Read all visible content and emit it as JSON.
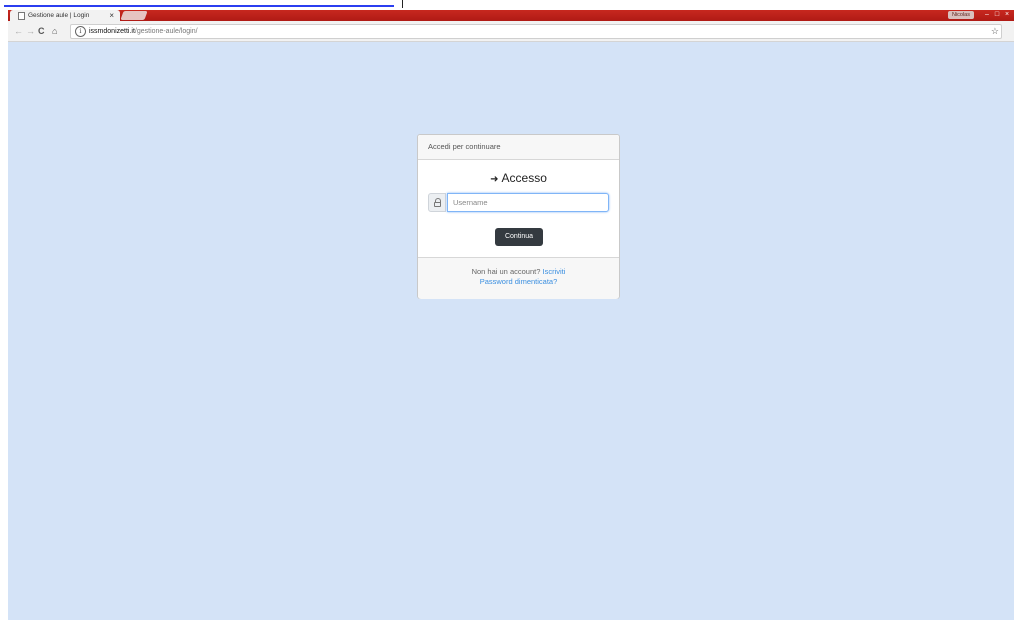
{
  "browser": {
    "tab_title": "Gestione aule | Login",
    "tab_close": "×",
    "user_badge": "Nicolas",
    "window_controls": [
      "–",
      "□",
      "×"
    ],
    "nav": {
      "back": "←",
      "forward": "→",
      "reload": "C",
      "home": "⌂"
    },
    "url_domain": "issmdonizetti.it",
    "url_path": "/gestione-aule/login/",
    "bookmark_star": "☆"
  },
  "login": {
    "header": "Accedi per continuare",
    "title_icon": "➜",
    "title": "Accesso",
    "username_placeholder": "Username",
    "username_value": "",
    "submit_label": "Continua",
    "no_account_text": "Non hai un account?",
    "signup_link": "Iscriviti",
    "forgot_password_link": "Password dimenticata?"
  },
  "icons": {
    "tab": "page-icon",
    "username": "lock-icon",
    "title": "sign-in-icon"
  },
  "colors": {
    "background": "#d4e3f7",
    "titlebar": "#c7281f",
    "button": "#343a40",
    "link": "#3b8fe0",
    "input_focus": "#80b5f7"
  }
}
